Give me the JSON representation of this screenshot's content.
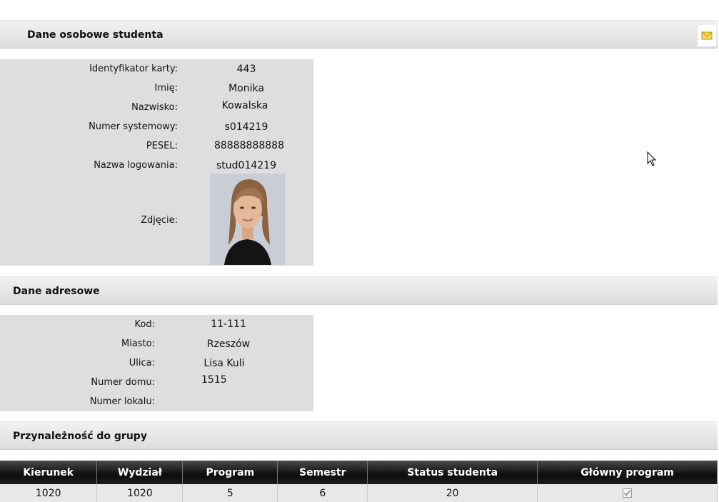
{
  "personal": {
    "title": "Dane osobowe studenta",
    "mail_icon": "envelope-icon",
    "fields": [
      {
        "label": "Identyfikator karty:",
        "value": "443"
      },
      {
        "label": "Imię:",
        "value": "Monika"
      },
      {
        "label": "Nazwisko:",
        "value": "Kowalska"
      },
      {
        "label": "Numer systemowy:",
        "value": "s014219"
      },
      {
        "label": "PESEL:",
        "value": "88888888888"
      },
      {
        "label": "Nazwa logowania:",
        "value": "stud014219"
      }
    ],
    "photo_label": "Zdjęcie:"
  },
  "address": {
    "title": "Dane adresowe",
    "fields": [
      {
        "label": "Kod:",
        "value": "11-111"
      },
      {
        "label": "Miasto:",
        "value": "Rzeszów"
      },
      {
        "label": "Ulica:",
        "value": "Lisa Kuli"
      },
      {
        "label": "Numer domu:",
        "value": "1515"
      },
      {
        "label": "Numer lokalu:",
        "value": ""
      }
    ]
  },
  "group": {
    "title": "Przynależność do grupy",
    "columns": [
      "Kierunek",
      "Wydział",
      "Program",
      "Semestr",
      "Status studenta",
      "Główny program"
    ],
    "rows": [
      {
        "kierunek": "1020",
        "wydzial": "1020",
        "program": "5",
        "semestr": "6",
        "status": "20",
        "glowny": true
      }
    ]
  },
  "colors": {
    "panel_bg": "#dedede",
    "header_gradient_top": "#f2f2f2",
    "header_gradient_bottom": "#dcdcdc",
    "table_header_bg": "#111111"
  }
}
